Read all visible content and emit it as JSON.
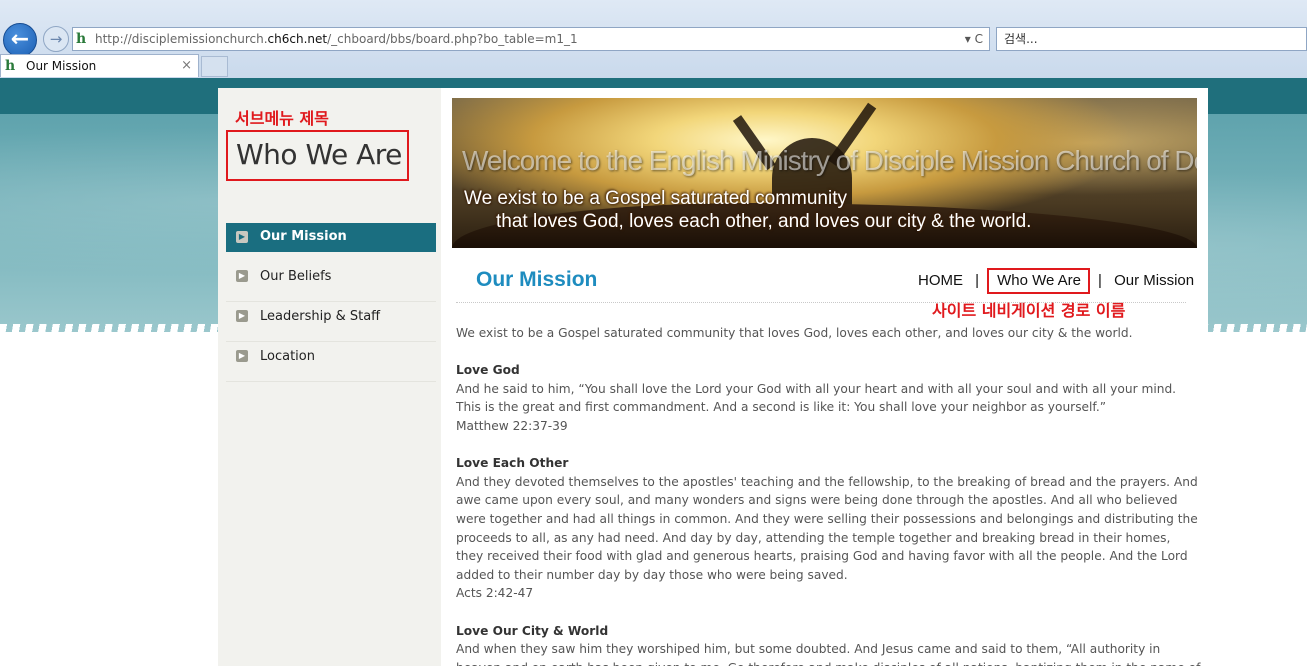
{
  "browser": {
    "back_icon": "back-arrow-icon",
    "forward_icon": "forward-arrow-icon",
    "url_prefix": "http://disciplemissionchurch.",
    "url_domain": "ch6ch.net",
    "url_suffix": "/_chboard/bbs/board.php?bo_table=m1_1",
    "address_controls": "▾ C",
    "search_placeholder": "검색...",
    "tab_title": "Our Mission",
    "tab_close": "×"
  },
  "sidebar": {
    "annotation": "서브메뉴 제목",
    "group_title": "Who We Are",
    "items": [
      {
        "label": "Our Mission",
        "active": true
      },
      {
        "label": "Our Beliefs",
        "active": false
      },
      {
        "label": "Leadership & Staff",
        "active": false
      },
      {
        "label": "Location",
        "active": false
      }
    ]
  },
  "banner": {
    "welcome": "Welcome to the English Ministry of Disciple Mission Church of Denver.",
    "line1": "We exist to be a Gospel saturated community",
    "line2": "that loves God, loves each other, and loves our city & the world."
  },
  "content": {
    "title": "Our Mission",
    "breadcrumb": {
      "home": "HOME",
      "separator": "|",
      "parent": "Who We Are",
      "current": "Our Mission",
      "annotation": "사이트 네비게이션 경로 이름"
    },
    "intro": "We exist to be a Gospel saturated community that loves God, loves each other, and loves our city & the world.",
    "sections": [
      {
        "title": "Love God",
        "body": "And he said to him, “You shall love the Lord your God with all your heart and with all your soul and with all your mind. This is the great and first commandment. And a second is like it: You shall love your neighbor as yourself.”",
        "ref": "Matthew 22:37-39"
      },
      {
        "title": "Love Each Other",
        "body": "And they devoted themselves to the apostles' teaching and the fellowship, to the breaking of bread and the prayers. And awe came upon every soul, and many wonders and signs were being done through the apostles. And all who believed were together and had all things in common. And they were selling their possessions and belongings and distributing the proceeds to all, as any had need. And day by day, attending the temple together and breaking bread in their homes, they received their food with glad and generous hearts, praising God and having favor with all the people. And the Lord added to their number day by day those who were being saved.",
        "ref": "Acts 2:42-47"
      },
      {
        "title": "Love Our City & World",
        "body": "And when they saw him they worshiped him, but some doubted. And Jesus came and said to them, “All authority in heaven and on earth has been given to me. Go therefore and make disciples of all nations, baptizing them in the name of",
        "ref": ""
      }
    ]
  },
  "colors": {
    "accent_teal": "#1a6e80",
    "title_blue": "#1e8cbf",
    "annotation_red": "#e0191d"
  }
}
